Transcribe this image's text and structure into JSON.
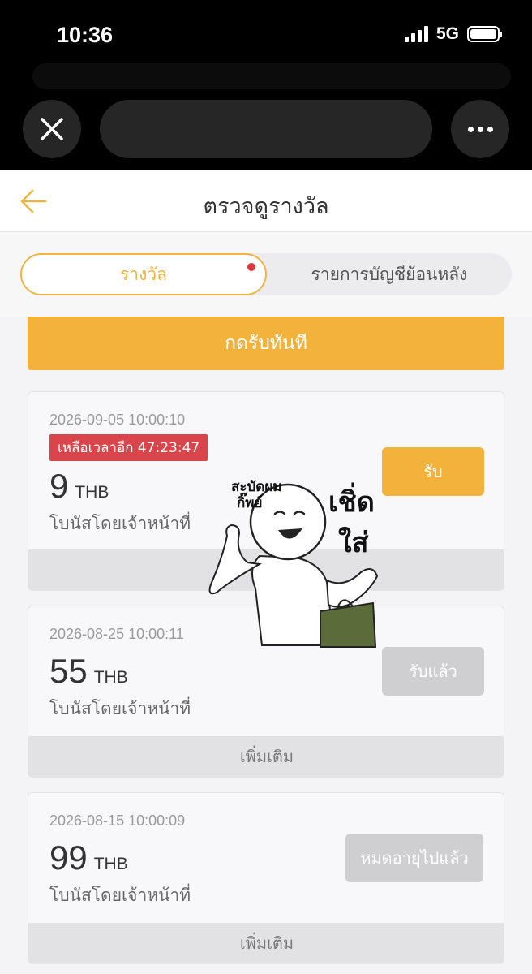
{
  "status_bar": {
    "time": "10:36",
    "network": "5G",
    "icons": [
      "signal-icon",
      "battery-icon"
    ]
  },
  "browser": {
    "icons": [
      "close-icon",
      "more-icon"
    ]
  },
  "header": {
    "title": "ตรวจดูรางวัล",
    "back_icon": "arrow-left-icon"
  },
  "tabs": [
    {
      "label": "รางวัล",
      "active": true,
      "has_dot": true
    },
    {
      "label": "รายการบัญชีย้อนหลัง",
      "active": false
    }
  ],
  "claim_all_label": "กดรับทันที",
  "rewards": [
    {
      "date": "2026-09-05 10:00:10",
      "timer": "เหลือเวลาอีก 47:23:47",
      "amount": "9",
      "currency": "THB",
      "desc": "โบนัสโดยเจ้าหน้าที่",
      "button": "รับ",
      "more": ""
    },
    {
      "date": "2026-08-25 10:00:11",
      "amount": "55",
      "currency": "THB",
      "desc": "โบนัสโดยเจ้าหน้าที่",
      "button": "รับแล้ว",
      "more": "เพิ่มเติม"
    },
    {
      "date": "2026-08-15 10:00:09",
      "amount": "99",
      "currency": "THB",
      "desc": "โบนัสโดยเจ้าหน้าที่",
      "button": "หมดอายุไปแล้ว",
      "more": "เพิ่มเติม"
    }
  ],
  "sticker": {
    "left_text": "สะบัดผม กิ๊พย์",
    "left_text_line1": "สะบัดผม",
    "left_text_line2": "กิ๊พย์",
    "right_text": "เชิ่ด ใส่",
    "right_text_line1": "เชิ่ด",
    "right_text_line2": "ใส่"
  },
  "colors": {
    "accent": "#f2b23c",
    "timer_red": "#d9454b",
    "disabled": "#cfcfd1"
  }
}
